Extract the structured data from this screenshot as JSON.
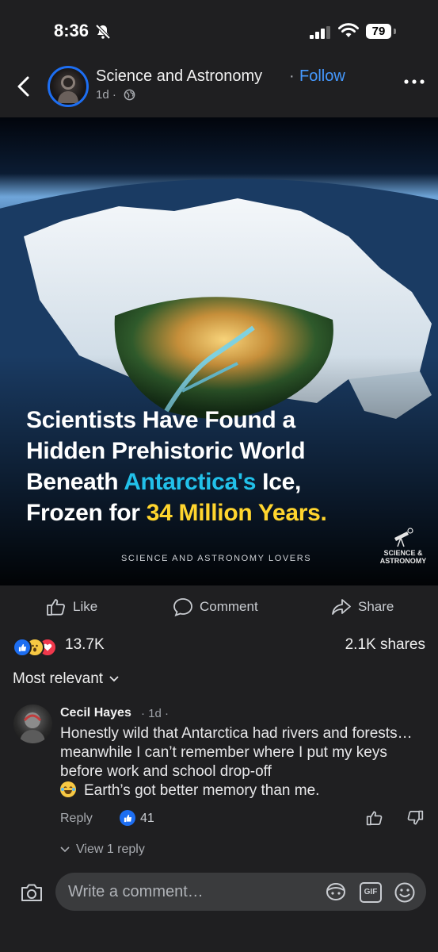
{
  "status": {
    "time": "8:36",
    "battery": "79"
  },
  "post": {
    "page_name": "Science and Astronomy",
    "separator": "·",
    "follow_label": "Follow",
    "time": "1d ·",
    "image": {
      "caption_line1": "Scientists Have Found a",
      "caption_line2": "Hidden Prehistoric World",
      "caption_line3_a": "Beneath ",
      "caption_line3_b": "Antarctica's",
      "caption_line3_c": " Ice,",
      "caption_line4_a": "Frozen for ",
      "caption_line4_b": "34 Million Years.",
      "credit": "SCIENCE AND ASTRONOMY LOVERS",
      "logo_line1": "SCIENCE &",
      "logo_line2": "ASTRONOMY"
    },
    "actions": {
      "like": "Like",
      "comment": "Comment",
      "share": "Share"
    },
    "reaction_count": "13.7K",
    "share_count": "2.1K shares"
  },
  "comments": {
    "sort_label": "Most relevant",
    "items": [
      {
        "author": "Cecil Hayes",
        "time": "· 1d ·",
        "text_main": "Honestly wild that Antarctica had rivers and forests… meanwhile I can’t remember where I put my keys before work and school drop-off",
        "text_end": "Earth’s got better memory than me.",
        "reply_label": "Reply",
        "like_count": "41",
        "view_replies": "View 1 reply"
      }
    ]
  },
  "composer": {
    "placeholder": "Write a comment…",
    "gif_label": "GIF"
  },
  "colors": {
    "accent": "#4599ff",
    "like_blue": "#1d6ef2",
    "background": "#1f1f21",
    "highlight_cyan": "#22c1ea",
    "highlight_yellow": "#ffd52e"
  }
}
